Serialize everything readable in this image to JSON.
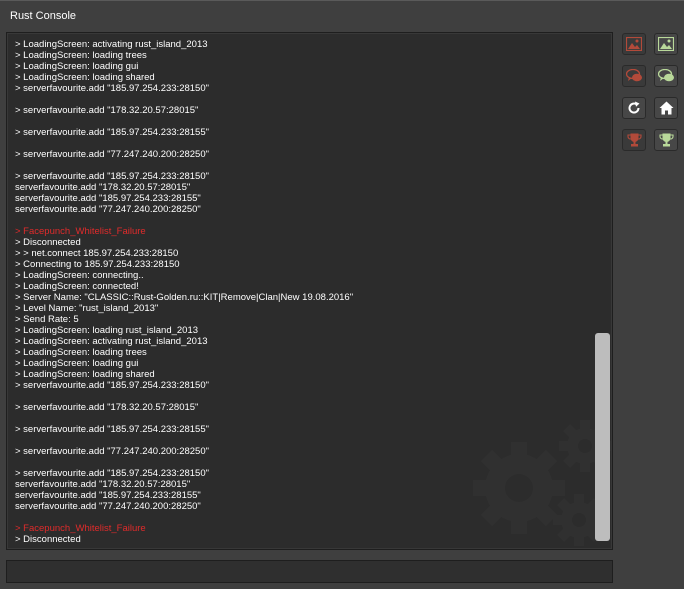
{
  "window": {
    "title": "Rust Console"
  },
  "console": {
    "lines": [
      {
        "text": "> LoadingScreen: activating rust_island_2013",
        "type": "normal"
      },
      {
        "text": "> LoadingScreen: loading trees",
        "type": "normal"
      },
      {
        "text": "> LoadingScreen: loading gui",
        "type": "normal"
      },
      {
        "text": "> LoadingScreen: loading shared",
        "type": "normal"
      },
      {
        "text": "> serverfavourite.add \"185.97.254.233:28150\"",
        "type": "normal"
      },
      {
        "text": "",
        "type": "blank"
      },
      {
        "text": "> serverfavourite.add \"178.32.20.57:28015\"",
        "type": "normal"
      },
      {
        "text": "",
        "type": "blank"
      },
      {
        "text": "> serverfavourite.add \"185.97.254.233:28155\"",
        "type": "normal"
      },
      {
        "text": "",
        "type": "blank"
      },
      {
        "text": "> serverfavourite.add \"77.247.240.200:28250\"",
        "type": "normal"
      },
      {
        "text": "",
        "type": "blank"
      },
      {
        "text": "> serverfavourite.add \"185.97.254.233:28150\"",
        "type": "normal"
      },
      {
        "text": "serverfavourite.add \"178.32.20.57:28015\"",
        "type": "normal"
      },
      {
        "text": "serverfavourite.add \"185.97.254.233:28155\"",
        "type": "normal"
      },
      {
        "text": "serverfavourite.add \"77.247.240.200:28250\"",
        "type": "normal"
      },
      {
        "text": "",
        "type": "blank"
      },
      {
        "text": "> Facepunch_Whitelist_Failure",
        "type": "error"
      },
      {
        "text": "> Disconnected",
        "type": "normal"
      },
      {
        "text": "> > net.connect 185.97.254.233:28150",
        "type": "normal"
      },
      {
        "text": "> Connecting to 185.97.254.233:28150",
        "type": "normal"
      },
      {
        "text": "> LoadingScreen: connecting..",
        "type": "normal"
      },
      {
        "text": "> LoadingScreen: connected!",
        "type": "normal"
      },
      {
        "text": "> Server Name: \"CLASSIC::Rust-Golden.ru::KIT|Remove|Clan|New 19.08.2016\"",
        "type": "normal"
      },
      {
        "text": "> Level Name: \"rust_island_2013\"",
        "type": "normal"
      },
      {
        "text": "> Send Rate: 5",
        "type": "normal"
      },
      {
        "text": "> LoadingScreen: loading rust_island_2013",
        "type": "normal"
      },
      {
        "text": "> LoadingScreen: activating rust_island_2013",
        "type": "normal"
      },
      {
        "text": "> LoadingScreen: loading trees",
        "type": "normal"
      },
      {
        "text": "> LoadingScreen: loading gui",
        "type": "normal"
      },
      {
        "text": "> LoadingScreen: loading shared",
        "type": "normal"
      },
      {
        "text": "> serverfavourite.add \"185.97.254.233:28150\"",
        "type": "normal"
      },
      {
        "text": "",
        "type": "blank"
      },
      {
        "text": "> serverfavourite.add \"178.32.20.57:28015\"",
        "type": "normal"
      },
      {
        "text": "",
        "type": "blank"
      },
      {
        "text": "> serverfavourite.add \"185.97.254.233:28155\"",
        "type": "normal"
      },
      {
        "text": "",
        "type": "blank"
      },
      {
        "text": "> serverfavourite.add \"77.247.240.200:28250\"",
        "type": "normal"
      },
      {
        "text": "",
        "type": "blank"
      },
      {
        "text": "> serverfavourite.add \"185.97.254.233:28150\"",
        "type": "normal"
      },
      {
        "text": "serverfavourite.add \"178.32.20.57:28015\"",
        "type": "normal"
      },
      {
        "text": "serverfavourite.add \"185.97.254.233:28155\"",
        "type": "normal"
      },
      {
        "text": "serverfavourite.add \"77.247.240.200:28250\"",
        "type": "normal"
      },
      {
        "text": "",
        "type": "blank"
      },
      {
        "text": "> Facepunch_Whitelist_Failure",
        "type": "error"
      },
      {
        "text": "> Disconnected",
        "type": "normal"
      }
    ],
    "input_value": "",
    "error_color": "#e02b2b"
  },
  "side_buttons": [
    {
      "name": "image-off-button",
      "icon": "image-icon",
      "state": "dim"
    },
    {
      "name": "image-on-button",
      "icon": "image-icon",
      "state": "lit"
    },
    {
      "name": "chat-off-button",
      "icon": "chat-bubbles-icon",
      "state": "dim"
    },
    {
      "name": "chat-on-button",
      "icon": "chat-bubbles-icon",
      "state": "lit"
    },
    {
      "name": "refresh-button",
      "icon": "refresh-icon",
      "state": "lit"
    },
    {
      "name": "home-button",
      "icon": "home-icon",
      "state": "lit"
    },
    {
      "name": "trophy-off-button",
      "icon": "trophy-icon",
      "state": "dim"
    },
    {
      "name": "trophy-on-button",
      "icon": "trophy-icon",
      "state": "lit"
    }
  ],
  "colors": {
    "background": "#3f3f3f",
    "console_bg": "#2c2c2c",
    "icon_red": "#b24a3a",
    "icon_green": "#b9d99a",
    "scroll_thumb": "#bdbdbd"
  }
}
